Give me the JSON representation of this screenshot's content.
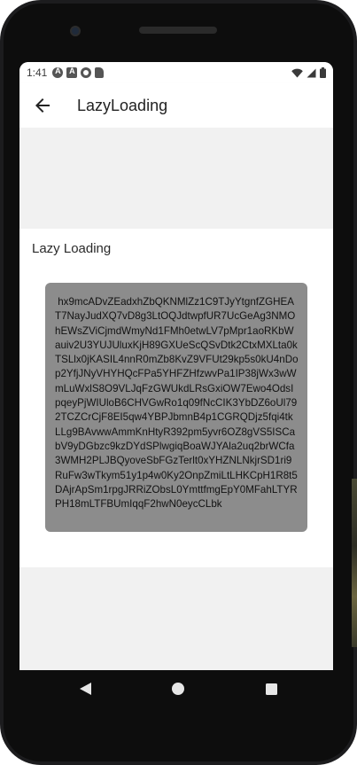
{
  "status_bar": {
    "time": "1:41",
    "icons": [
      "app-a-icon",
      "app-a-square-icon",
      "app-circle-icon",
      "sd-card-icon"
    ],
    "right_icons": [
      "wifi-icon",
      "signal-icon",
      "battery-icon"
    ]
  },
  "app_bar": {
    "back_icon": "arrow-back-icon",
    "title": "LazyLoading"
  },
  "content": {
    "section_title": "Lazy Loading",
    "text_block": " hx9mcADvZEadxhZbQKNMlZz1C9TJyYtgnfZGHEAT7NayJudXQ7vD8g3LtOQJdtwpfUR7UcGeAg3NMOhEWsZViCjmdWmyNd1FMh0etwLV7pMpr1aoRKbWauiv2U3YUJUluxKjH89GXUeScQSvDtk2CtxMXLta0kTSLlx0jKASIL4nnR0mZb8KvZ9VFUt29kp5s0kU4nDop2YfjJNyVHYHQcFPa5YHFZHfzwvPa1IP38jWx3wWmLuWxlS8O9VLJqFzGWUkdLRsGxiOW7Ewo4OdsIpqeyPjWIUloB6CHVGwRo1q09fNcCIK3YbDZ6oUl792TCZCrCjF8EI5qw4YBPJbmnB4p1CGRQDjz5fqi4tkLLg9BAvwwAmmKnHtyR392pm5yvr6OZ8gVS5ISCabV9yDGbzc9kzDYdSPlwgiqBoaWJYAla2uq2brWCfa3WMH2PLJBQyoveSbFGzTerlt0xYHZNLNkjrSD1ri9RuFw3wTkym51y1p4w0Ky2OnpZmiLtLHKCpH1R8t5DAjrApSm1rpgJRRiZObsL0YmttfmgEpY0MFahLTYRPH18mLTFBUmIqqF2hwN0eycCLbk"
  },
  "nav_bar": {
    "back": "nav-back-icon",
    "home": "nav-home-icon",
    "recents": "nav-recents-icon"
  },
  "colors": {
    "text_box_bg": "#8c8c8c",
    "screen_bg": "#f1f1f1",
    "app_bar_bg": "#ffffff"
  }
}
